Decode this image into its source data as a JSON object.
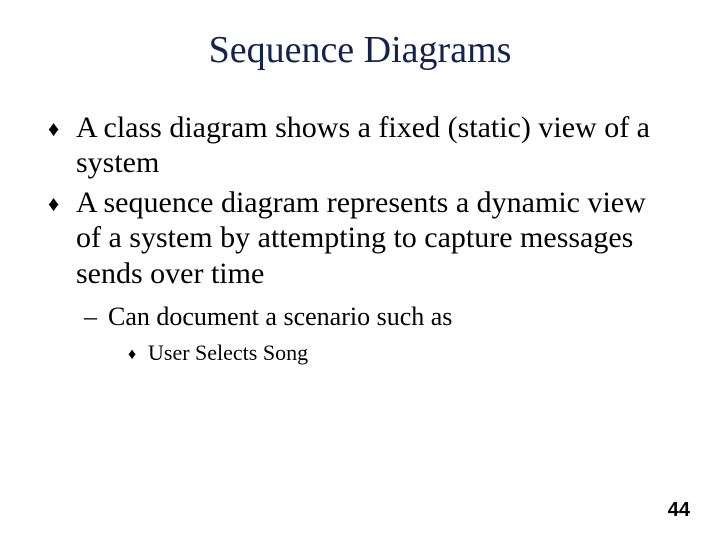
{
  "title": "Sequence Diagrams",
  "bullets": {
    "b1": "A class diagram shows a fixed (static) view of a system",
    "b2": "A sequence diagram represents a dynamic view of a system by attempting to capture messages sends over time",
    "b2_sub1": "Can document a scenario such as",
    "b2_sub1_sub1": "User Selects Song"
  },
  "markers": {
    "diamond": "♦",
    "dash": "–"
  },
  "page_number": "44"
}
